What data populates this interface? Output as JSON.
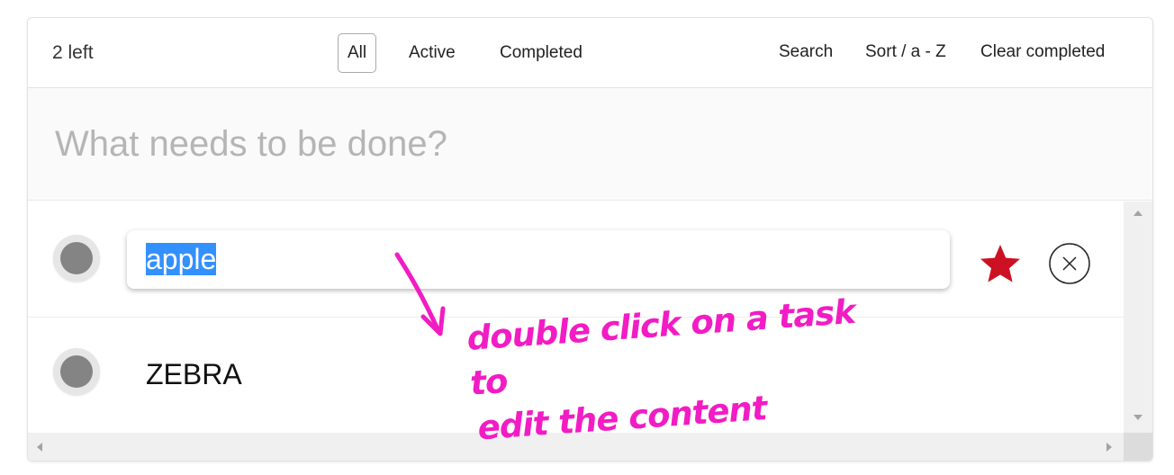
{
  "toolbar": {
    "items_left": "2 left",
    "filters": {
      "all": "All",
      "active": "Active",
      "completed": "Completed",
      "selected": "All"
    },
    "search": "Search",
    "sort": "Sort / a - Z",
    "clear_completed": "Clear completed"
  },
  "new_todo": {
    "placeholder": "What needs to be done?",
    "value": ""
  },
  "todos": [
    {
      "title": "apple",
      "editing": true,
      "text_selected": true,
      "starred": true,
      "star_color": "#cc1122"
    },
    {
      "title": "ZEBRA",
      "editing": false,
      "starred": false
    }
  ],
  "annotation": {
    "line1": "double click on a task to",
    "line2": "edit the content",
    "color": "#f21cc4"
  },
  "colors": {
    "selection": "#3390ff",
    "toggle_dot": "#848484",
    "star": "#cc1122"
  }
}
